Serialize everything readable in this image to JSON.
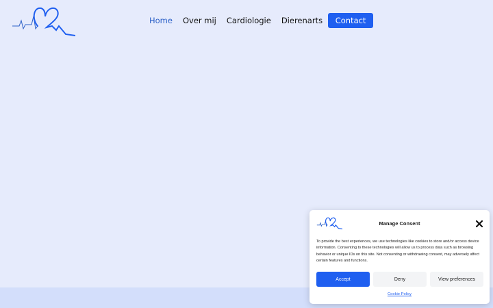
{
  "header": {
    "nav": [
      {
        "label": "Home",
        "active": true
      },
      {
        "label": "Over mij",
        "active": false
      },
      {
        "label": "Cardiologie",
        "active": false
      },
      {
        "label": "Dierenarts",
        "active": false
      }
    ],
    "contact_label": "Contact"
  },
  "consent": {
    "title": "Manage Consent",
    "body": "To provide the best experiences, we use technologies like cookies to store and/or access device information. Consenting to these technologies will allow us to process data such as browsing behavior or unique IDs on this site. Not consenting or withdrawing consent, may adversely affect certain features and functions.",
    "accept_label": "Accept",
    "deny_label": "Deny",
    "preferences_label": "View preferences",
    "policy_label": "Cookie Policy"
  },
  "colors": {
    "background": "#e6ebfc",
    "accent": "#1f5ff0",
    "active_nav": "#2a5fc7",
    "footer_band": "#d3defb"
  },
  "icons": {
    "logo": "heart-ekg-logo",
    "close": "close-icon"
  }
}
